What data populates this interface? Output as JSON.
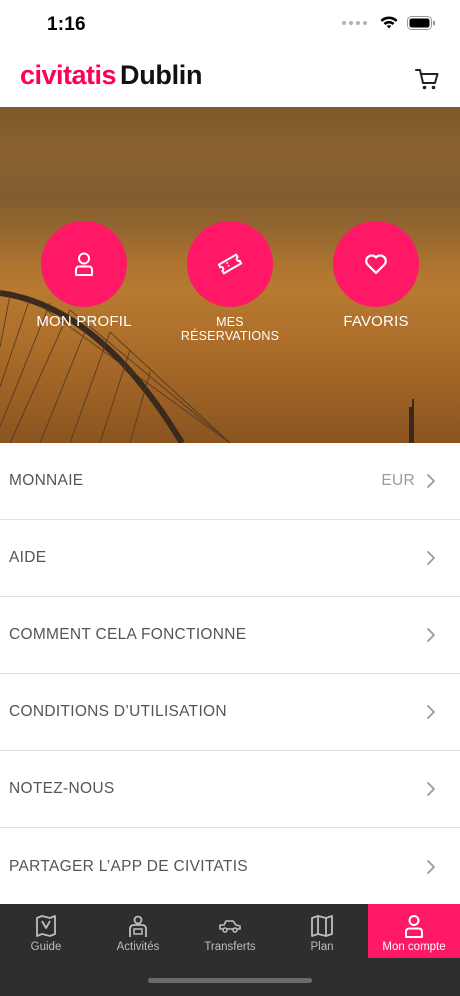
{
  "status_bar": {
    "time": "1:16"
  },
  "header": {
    "brand": "civitatis",
    "city": "Dublin"
  },
  "hero_actions": [
    {
      "label": "MON PROFIL",
      "icon": "user-icon"
    },
    {
      "label": "MES RÉSERVATIONS",
      "icon": "ticket-icon"
    },
    {
      "label": "FAVORIS",
      "icon": "heart-icon"
    }
  ],
  "menu": [
    {
      "label": "MONNAIE",
      "value": "EUR"
    },
    {
      "label": "AIDE"
    },
    {
      "label": "COMMENT CELA FONCTIONNE"
    },
    {
      "label": "CONDITIONS D’UTILISATION"
    },
    {
      "label": "NOTEZ-NOUS"
    },
    {
      "label": "PARTAGER L’APP DE CIVITATIS"
    }
  ],
  "tabs": [
    {
      "label": "Guide",
      "icon": "map-book-icon"
    },
    {
      "label": "Activités",
      "icon": "guide-person-icon"
    },
    {
      "label": "Transferts",
      "icon": "car-icon"
    },
    {
      "label": "Plan",
      "icon": "map-icon"
    },
    {
      "label": "Mon compte",
      "icon": "user-icon",
      "active": true
    }
  ],
  "colors": {
    "accent": "#ff1866",
    "tabbar": "#2e2e2e"
  }
}
